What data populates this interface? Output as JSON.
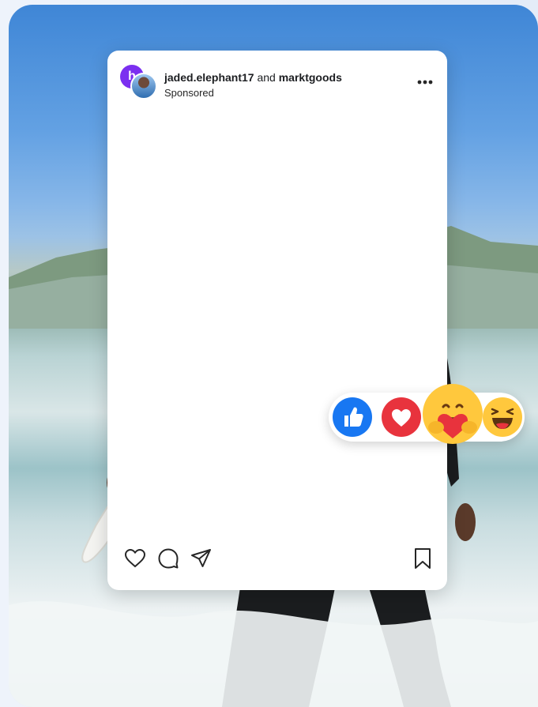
{
  "post": {
    "brand_badge": "h",
    "author": "jaded.elephant17",
    "connector": "and",
    "partner": "marktgoods",
    "label": "Sponsored"
  },
  "icons": {
    "more": "more-options-icon",
    "like": "heart-outline-icon",
    "comment": "comment-icon",
    "share": "send-icon",
    "save": "bookmark-icon"
  },
  "reactions": [
    "like-reaction",
    "love-reaction",
    "care-reaction",
    "haha-reaction"
  ],
  "colors": {
    "brand_badge": "#7b2ff0",
    "like_reaction": "#1877f2",
    "love_reaction": "#e8333d",
    "emoji_yellow": "#ffc83d"
  }
}
